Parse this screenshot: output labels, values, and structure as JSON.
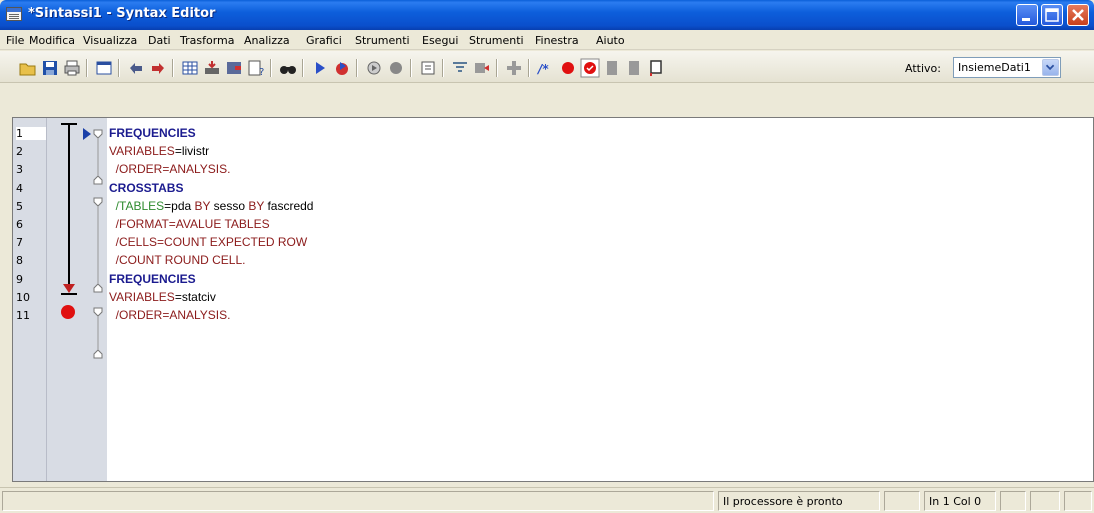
{
  "window": {
    "title": "*Sintassi1 - Syntax Editor",
    "controls": [
      "minimize-icon",
      "maximize-icon",
      "close-icon"
    ]
  },
  "menu": {
    "items": [
      "File",
      "Modifica",
      "Visualizza",
      "Dati",
      "Trasforma",
      "Analizza",
      "Grafici",
      "Strumenti",
      "Esegui",
      "Strumenti",
      "Finestra",
      "Aiuto"
    ]
  },
  "toolbar": {
    "icons": [
      "open-folder-icon",
      "save-icon",
      "print-icon",
      "dialog-recall-icon",
      "undo-icon",
      "redo-icon",
      "goto-data-icon",
      "goto-case-icon",
      "goto-variable-icon",
      "variables-icon",
      "find-icon",
      "run-icon",
      "stop-icon",
      "run-all-icon",
      "run-to-end-icon",
      "toggle-bookmark-icon",
      "comment-icon",
      "uncomment-icon",
      "insert-icon",
      "comment-selection-icon",
      "breakpoint-icon",
      "validate-icon",
      "bookmark-icon",
      "bookmark-prev-icon",
      "bookmark-next-icon"
    ],
    "active_label": "Attivo:",
    "active_dataset": "InsiemeDati1"
  },
  "editor": {
    "lines": [
      {
        "num": "1",
        "segments": [
          {
            "t": "FREQUENCIES",
            "c": "kw"
          }
        ]
      },
      {
        "num": "2",
        "segments": [
          {
            "t": "VARIABLES",
            "c": "sub"
          },
          {
            "t": "=livistr",
            "c": "plain"
          }
        ]
      },
      {
        "num": "3",
        "segments": [
          {
            "t": "  /ORDER=ANALYSIS.",
            "c": "sub"
          }
        ]
      },
      {
        "num": "4",
        "segments": [
          {
            "t": "CROSSTABS",
            "c": "kw"
          }
        ]
      },
      {
        "num": "5",
        "segments": [
          {
            "t": "  /TABLES",
            "c": "sub2"
          },
          {
            "t": "=pda ",
            "c": "plain"
          },
          {
            "t": "BY",
            "c": "sub"
          },
          {
            "t": " sesso ",
            "c": "plain"
          },
          {
            "t": "BY",
            "c": "sub"
          },
          {
            "t": " fascredd",
            "c": "plain"
          }
        ]
      },
      {
        "num": "6",
        "segments": [
          {
            "t": "  /FORMAT=AVALUE TABLES",
            "c": "sub"
          }
        ]
      },
      {
        "num": "7",
        "segments": [
          {
            "t": "  /CELLS=COUNT EXPECTED ROW",
            "c": "sub"
          }
        ]
      },
      {
        "num": "8",
        "segments": [
          {
            "t": "  /COUNT ROUND CELL.",
            "c": "sub"
          }
        ]
      },
      {
        "num": "9",
        "segments": [
          {
            "t": "FREQUENCIES",
            "c": "kw"
          }
        ]
      },
      {
        "num": "10",
        "segments": [
          {
            "t": "VARIABLES",
            "c": "sub"
          },
          {
            "t": "=statciv",
            "c": "plain"
          }
        ]
      },
      {
        "num": "11",
        "segments": [
          {
            "t": "  /ORDER=ANALYSIS.",
            "c": "sub"
          }
        ]
      }
    ]
  },
  "status": {
    "message": "Il processore è pronto",
    "position": "In 1 Col 0"
  },
  "colors": {
    "title_blue": "#0a4fcc",
    "keyword": "#1b1b8f",
    "subcommand": "#8b1a1a",
    "green": "#2e8b2e",
    "breakpoint": "#e01010"
  }
}
